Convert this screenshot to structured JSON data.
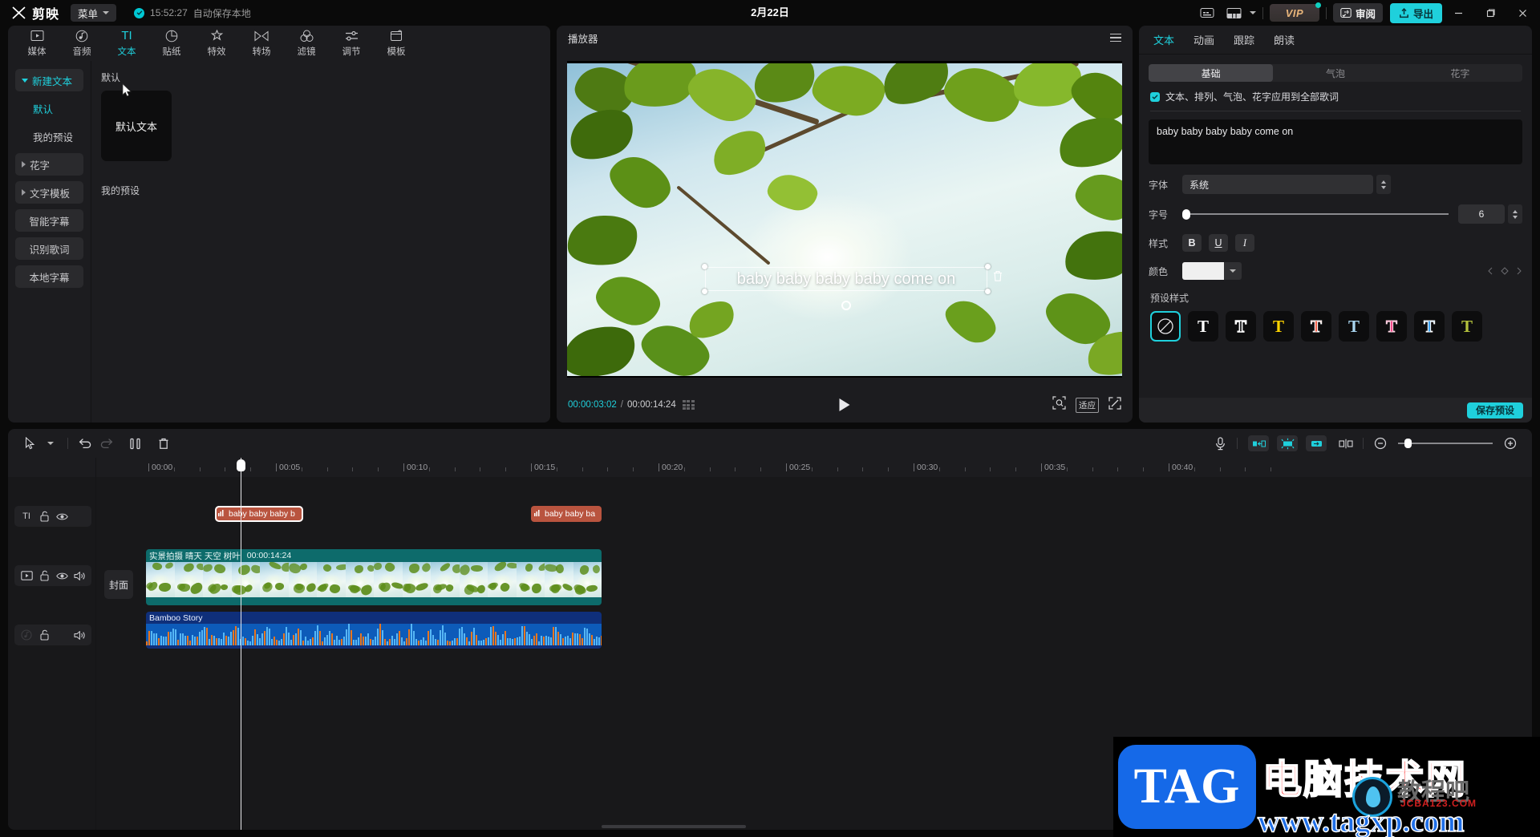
{
  "titlebar": {
    "app_name": "剪映",
    "menu_label": "菜单",
    "autosave_time": "15:52:27",
    "autosave_text": "自动保存本地",
    "project_date": "2月22日",
    "vip_label": "VIP",
    "review_label": "审阅",
    "export_label": "导出",
    "icons": {
      "captions": "captions-icon",
      "layout": "layout-icon",
      "minimize": "minimize-icon",
      "maximize": "maximize-icon",
      "close": "close-icon"
    }
  },
  "media_tabs": [
    {
      "label": "媒体",
      "icon": "media-icon",
      "active": false
    },
    {
      "label": "音频",
      "icon": "audio-icon",
      "active": false
    },
    {
      "label": "文本",
      "icon": "text-icon",
      "active": true
    },
    {
      "label": "贴纸",
      "icon": "sticker-icon",
      "active": false
    },
    {
      "label": "特效",
      "icon": "effects-icon",
      "active": false
    },
    {
      "label": "转场",
      "icon": "transition-icon",
      "active": false
    },
    {
      "label": "滤镜",
      "icon": "filter-icon",
      "active": false
    },
    {
      "label": "调节",
      "icon": "adjust-icon",
      "active": false
    },
    {
      "label": "模板",
      "icon": "template-icon",
      "active": false
    }
  ],
  "left_nav": [
    {
      "label": "新建文本",
      "type": "group",
      "expanded": true,
      "selected": true
    },
    {
      "label": "默认",
      "type": "sub",
      "selected": true
    },
    {
      "label": "我的预设",
      "type": "sub",
      "selected": false
    },
    {
      "label": "花字",
      "type": "group",
      "expanded": false,
      "selected": false
    },
    {
      "label": "文字模板",
      "type": "group",
      "expanded": false,
      "selected": false
    },
    {
      "label": "智能字幕",
      "type": "item",
      "selected": false
    },
    {
      "label": "识别歌词",
      "type": "item",
      "selected": false
    },
    {
      "label": "本地字幕",
      "type": "item",
      "selected": false
    }
  ],
  "left_content": {
    "section_default": "默认",
    "default_text_card": "默认文本",
    "section_mypreset": "我的预设"
  },
  "player": {
    "title": "播放器",
    "caption_text": "baby baby baby baby come on",
    "current_time": "00:00:03:02",
    "total_time": "00:00:14:24",
    "fit_label": "适应",
    "icons": {
      "menu": "hamburger-icon",
      "play": "play-icon",
      "zoom": "zoom-preview-icon",
      "fullscreen": "fullscreen-icon",
      "grid": "grid-icon"
    }
  },
  "right_panel": {
    "tabs": [
      {
        "label": "文本",
        "active": true
      },
      {
        "label": "动画",
        "active": false
      },
      {
        "label": "跟踪",
        "active": false
      },
      {
        "label": "朗读",
        "active": false
      }
    ],
    "segments": [
      {
        "label": "基础",
        "active": true
      },
      {
        "label": "气泡",
        "active": false
      },
      {
        "label": "花字",
        "active": false
      }
    ],
    "apply_all_label": "文本、排列、气泡、花字应用到全部歌词",
    "apply_all_checked": true,
    "text_value": "baby baby baby baby come on",
    "font_label": "字体",
    "font_value": "系统",
    "size_label": "字号",
    "size_value": "6",
    "style_label": "样式",
    "style_buttons": [
      "B",
      "U",
      "I"
    ],
    "color_label": "颜色",
    "color_value": "#f0f0f0",
    "presets_label": "预设样式",
    "presets": [
      {
        "name": "none",
        "color": "none",
        "selected": true
      },
      {
        "name": "white",
        "color": "#ffffff",
        "selected": false
      },
      {
        "name": "outline",
        "color": "outline",
        "selected": false
      },
      {
        "name": "yellow",
        "color": "#ffd400",
        "selected": false
      },
      {
        "name": "red-outline",
        "color": "#f0604a",
        "selected": false
      },
      {
        "name": "lightblue",
        "color": "#a9d6f0",
        "selected": false
      },
      {
        "name": "pink",
        "color": "#f24b8a",
        "selected": false
      },
      {
        "name": "blue",
        "color": "#3ba0ee",
        "selected": false
      },
      {
        "name": "olive",
        "color": "#b4c23c",
        "selected": false
      }
    ],
    "save_preset_label": "保存预设"
  },
  "timeline": {
    "toolbar_icons": [
      "select-tool-icon",
      "dropdown-caret-icon",
      "undo-icon",
      "redo-icon",
      "split-icon",
      "delete-icon"
    ],
    "right_icons": [
      "microphone-icon",
      "keyframe-prev-icon",
      "keyframe-icon",
      "keyframe-next-icon",
      "mirror-split-icon",
      "zoom-out-icon",
      "zoom-in-icon"
    ],
    "ruler_labels": [
      "00:00",
      "00:05",
      "00:10",
      "00:15",
      "00:20",
      "00:25",
      "00:30",
      "00:35",
      "00:40"
    ],
    "cover_label": "封面",
    "tracks": [
      {
        "type": "text",
        "icon": "text-track-icon",
        "lock": "unlock-icon",
        "eye": "eye-icon",
        "mute": null
      },
      {
        "type": "video",
        "icon": "video-track-icon",
        "lock": "unlock-icon",
        "eye": "eye-icon",
        "mute": "speaker-icon"
      },
      {
        "type": "audio",
        "icon": "audio-track-icon",
        "lock": "unlock-icon",
        "eye": null,
        "mute": "speaker-icon"
      }
    ],
    "clips": {
      "text_clip_1": "baby baby baby b",
      "text_clip_2": "baby baby ba",
      "video_clip_tags": "实景拍摄 晴天 天空 树叶",
      "video_clip_duration": "00:00:14:24",
      "audio_clip_name": "Bamboo Story"
    }
  },
  "watermark": {
    "tag": "TAG",
    "cn_title": "电脑技术网",
    "url": "www.tagxp.com",
    "sub1": "教程吧",
    "sub2": "JCBA123.COM"
  }
}
